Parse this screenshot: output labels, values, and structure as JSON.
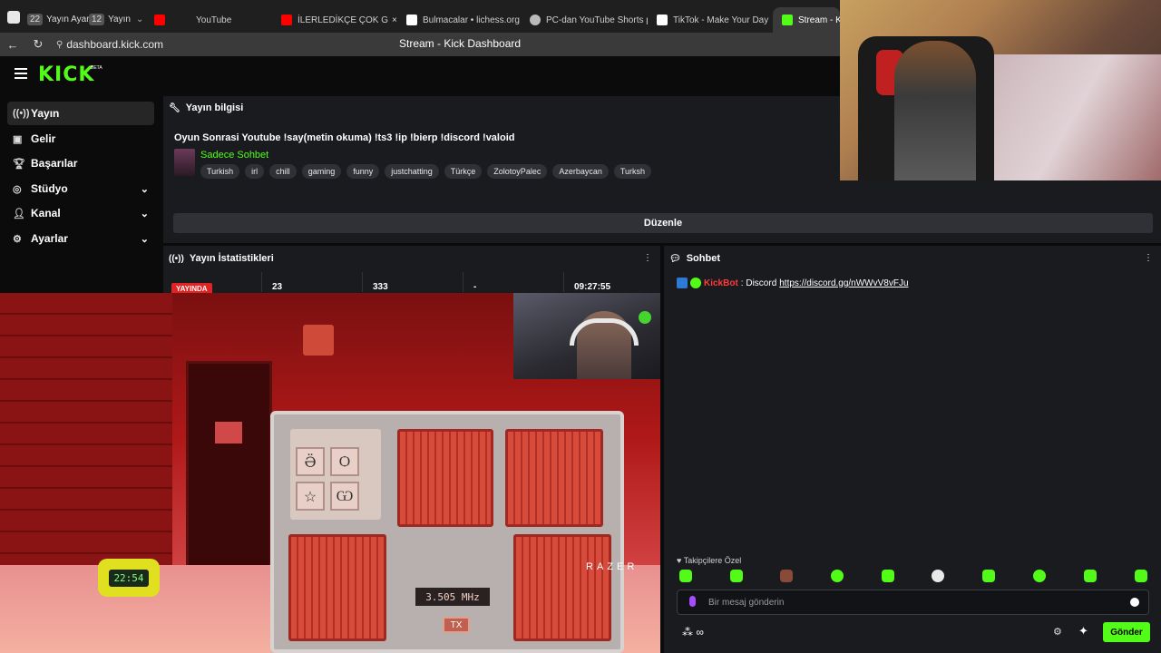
{
  "browser": {
    "tab_group_1": {
      "count": "22",
      "label": "Yayın Ayar"
    },
    "tab_group_2": {
      "count": "12",
      "label": "Yayın"
    },
    "tabs": [
      {
        "label": "YouTube",
        "fav_color": "#ff0000"
      },
      {
        "label": "İLERLEDİKÇE ÇOK G",
        "fav_color": "#ff0000"
      },
      {
        "label": "Bulmacalar • lichess.org",
        "fav_color": "#ffffff"
      },
      {
        "label": "PC-dan YouTube Shorts p",
        "fav_color": "#bbbbbb"
      },
      {
        "label": "TikTok - Make Your Day",
        "fav_color": "#ffffff"
      },
      {
        "label": "Stream - Kic",
        "fav_color": "#53fc18"
      }
    ],
    "url": "dashboard.kick.com",
    "page_title": "Stream - Kick Dashboard"
  },
  "kick": {
    "logo": "KICK",
    "beta": "BETA",
    "accent": "#53fc18"
  },
  "sidebar": {
    "items": [
      {
        "label": "Yayın",
        "icon": "broadcast-icon"
      },
      {
        "label": "Gelir",
        "icon": "wallet-icon"
      },
      {
        "label": "Başarılar",
        "icon": "trophy-icon"
      },
      {
        "label": "Stüdyo",
        "icon": "studio-icon"
      },
      {
        "label": "Kanal",
        "icon": "user-icon"
      },
      {
        "label": "Ayarlar",
        "icon": "gear-icon"
      }
    ]
  },
  "stream_info": {
    "heading": "Yayın bilgisi",
    "title": "Oyun Sonrasi Youtube !say(metin okuma) !ts3 !ip !bierp !discord !valoid",
    "category": "Sadece Sohbet",
    "tags": [
      "Turkish",
      "irl",
      "chill",
      "gaming",
      "funny",
      "justchatting",
      "Türkçe",
      "ZolotoyPalec",
      "Azerbaycan",
      "Turksh"
    ],
    "edit_label": "Düzenle"
  },
  "stats": {
    "heading": "Yayın İstatistikleri",
    "live_label": "YAYINDA",
    "viewers": "23",
    "followers": "333",
    "subs": "-",
    "uptime": "09:27:55"
  },
  "chat": {
    "heading": "Sohbet",
    "user": "KickBot",
    "message_prefix": ": Discord ",
    "link": "https://discord.gg/nWWvV8vFJu",
    "followers_only_label": "Takipçilere Özel",
    "placeholder": "Bir mesaj gönderin",
    "send_label": "Gönder",
    "infinity": "∞"
  },
  "game": {
    "clock_text": "22:54",
    "frequency": "3.505 MHz",
    "tx_label": "TX",
    "razer_text": "RAZER",
    "keys": [
      "Ӛ",
      "Ѻ",
      "☆",
      "Ѡ"
    ]
  }
}
